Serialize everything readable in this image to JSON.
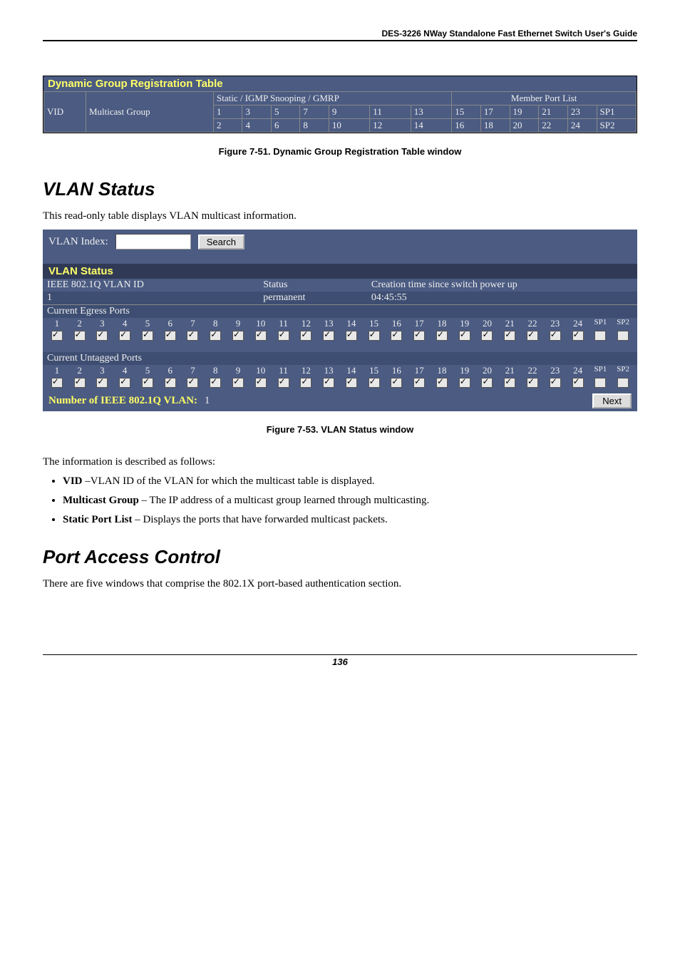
{
  "header": {
    "title": "DES-3226 NWay Standalone Fast Ethernet Switch User's Guide"
  },
  "dgrt": {
    "title": "Dynamic Group Registration Table",
    "col_vid": "VID",
    "col_mg": "Multicast Group",
    "col_sigs": "Static / IGMP Snooping / GMRP",
    "col_mpl": "Member Port List",
    "row1": [
      "1",
      "3",
      "5",
      "7",
      "9",
      "11",
      "13",
      "15",
      "17",
      "19",
      "21",
      "23",
      "SP1"
    ],
    "row2": [
      "2",
      "4",
      "6",
      "8",
      "10",
      "12",
      "14",
      "16",
      "18",
      "20",
      "22",
      "24",
      "SP2"
    ]
  },
  "caption1": "Figure 7-51.  Dynamic Group Registration Table window",
  "vlan_status": {
    "heading": "VLAN Status",
    "intro": "This read-only table displays VLAN multicast information.",
    "index_label": "VLAN Index:",
    "index_value": "",
    "search_button": "Search",
    "panel_title": "VLAN Status",
    "colA": "IEEE 802.1Q VLAN ID",
    "colB": "Status",
    "colC": "Creation time since switch power up",
    "valA": "1",
    "valB": "permanent",
    "valC": "04:45:55",
    "egress_title": "Current Egress Ports",
    "untagged_title": "Current Untagged Ports",
    "port_headers": [
      "1",
      "2",
      "3",
      "4",
      "5",
      "6",
      "7",
      "8",
      "9",
      "10",
      "11",
      "12",
      "13",
      "14",
      "15",
      "16",
      "17",
      "18",
      "19",
      "20",
      "21",
      "22",
      "23",
      "24",
      "SP1",
      "SP2"
    ],
    "egress_checked": [
      true,
      true,
      true,
      true,
      true,
      true,
      true,
      true,
      true,
      true,
      true,
      true,
      true,
      true,
      true,
      true,
      true,
      true,
      true,
      true,
      true,
      true,
      true,
      true,
      false,
      false
    ],
    "untagged_checked": [
      true,
      true,
      true,
      true,
      true,
      true,
      true,
      true,
      true,
      true,
      true,
      true,
      true,
      true,
      true,
      true,
      true,
      true,
      true,
      true,
      true,
      true,
      true,
      true,
      false,
      false
    ],
    "count_label": "Number of IEEE 802.1Q VLAN:",
    "count_value": "1",
    "next_button": "Next"
  },
  "caption2": "Figure 7-53.  VLAN Status window",
  "info": {
    "lead": "The information is described as follows:",
    "items": [
      {
        "b": "VID",
        "t": " –VLAN ID of the VLAN for which the multicast table is displayed."
      },
      {
        "b": "Multicast Group",
        "t": " – The IP address of a multicast group learned through multicasting."
      },
      {
        "b": "Static Port List",
        "t": " – Displays the ports that have forwarded multicast packets."
      }
    ]
  },
  "pac": {
    "heading": "Port Access Control",
    "intro": "There are five windows that comprise the 802.1X port-based authentication section."
  },
  "page_number": "136"
}
